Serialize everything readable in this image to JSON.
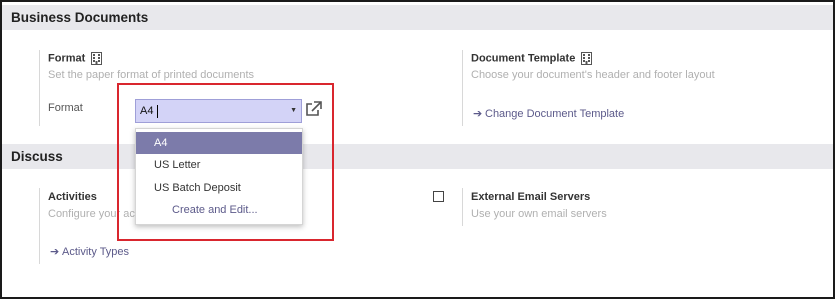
{
  "business_documents": {
    "heading": "Business Documents",
    "format": {
      "title": "Format",
      "description": "Set the paper format of printed documents",
      "field_label": "Format",
      "value": "A4",
      "options": [
        "A4",
        "US Letter",
        "US Batch Deposit"
      ],
      "create_edit": "Create and Edit..."
    },
    "document_template": {
      "title": "Document Template",
      "description": "Choose your document's header and footer layout",
      "link": "Change Document Template"
    }
  },
  "discuss": {
    "heading": "Discuss",
    "activities": {
      "title": "Activities",
      "description": "Configure your ac",
      "link": "Activity Types"
    },
    "external_email": {
      "title": "External Email Servers",
      "description": "Use your own email servers",
      "checked": false
    }
  },
  "colors": {
    "accent": "#7c7baa",
    "link": "#5c5a8a",
    "highlight_box": "#d9262e",
    "input_bg": "#d3d3f7"
  }
}
